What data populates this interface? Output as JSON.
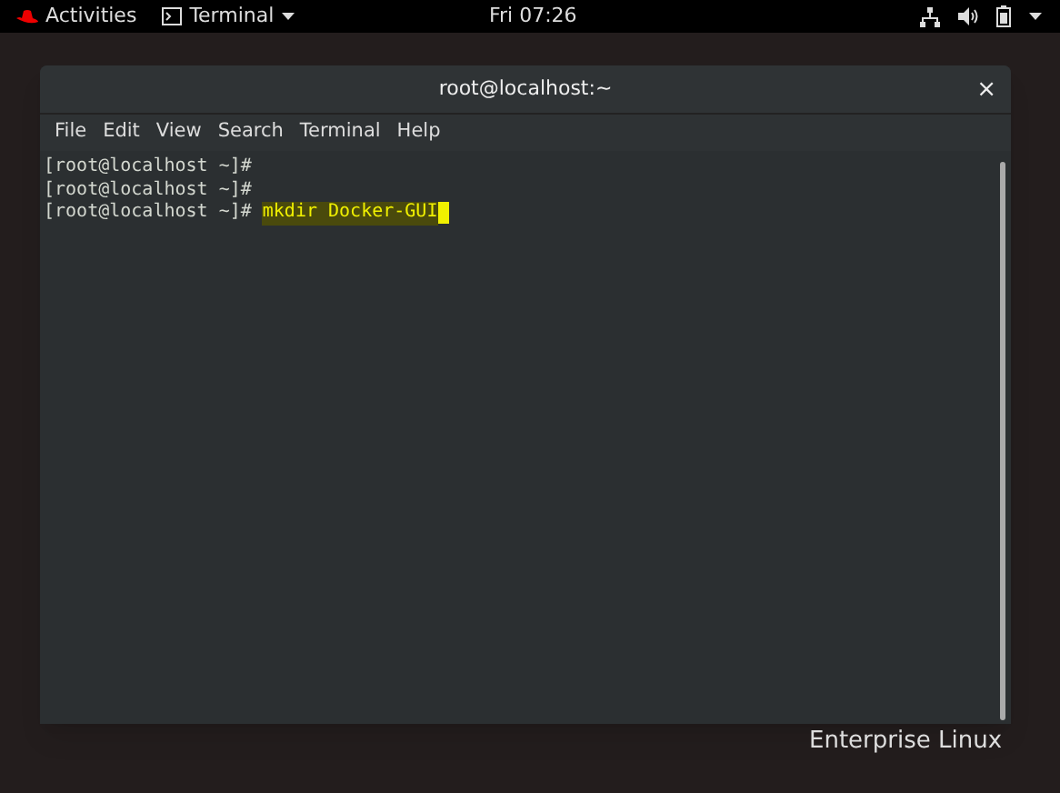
{
  "top_bar": {
    "activities": "Activities",
    "app_menu": "Terminal",
    "clock": "Fri 07:26"
  },
  "window": {
    "title": "root@localhost:~",
    "close": "×"
  },
  "menu": [
    "File",
    "Edit",
    "View",
    "Search",
    "Terminal",
    "Help"
  ],
  "terminal": {
    "lines": [
      {
        "prompt": "[root@localhost ~]#"
      },
      {
        "prompt": "[root@localhost ~]#"
      },
      {
        "prompt": "[root@localhost ~]#",
        "command": {
          "text": "mkdir Docker-GUI",
          "highlighted": true,
          "cursor": true
        }
      }
    ]
  },
  "desktop": {
    "brand": "Enterprise Linux"
  }
}
